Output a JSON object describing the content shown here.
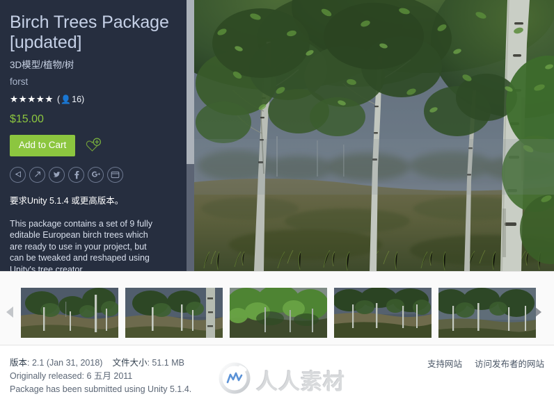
{
  "colors": {
    "panel_bg": "#262e3f",
    "accent_green": "#8cc63f",
    "title_text": "#c5d0e6",
    "page_bg": "#ffffff",
    "carousel_bg": "#fafafa",
    "scrollbar_thumb": "#acb2ba",
    "scrollbar_track": "#5c6474"
  },
  "info_panel": {
    "title": "Birch Trees Package [updated]",
    "breadcrumb": "3D模型/植物/树",
    "publisher": "forst",
    "rating": {
      "stars": "★★★★★",
      "star_count": 5,
      "open_paren": "(",
      "person_icon": "person-icon",
      "reviews": "16",
      "close_paren": ")"
    },
    "price": "$15.00",
    "add_to_cart_label": "Add to Cart",
    "wishlist_icon": "heart-plus-icon",
    "social_icons": [
      {
        "name": "share-icon",
        "glyph": "◁"
      },
      {
        "name": "external-link-icon",
        "glyph": "↗"
      },
      {
        "name": "twitter-icon",
        "glyph": "t"
      },
      {
        "name": "facebook-icon",
        "glyph": "f"
      },
      {
        "name": "google-plus-icon",
        "glyph": "g+"
      },
      {
        "name": "embed-window-icon",
        "glyph": "▤"
      }
    ],
    "unity_requirement": "要求Unity 5.1.4 或更高版本。",
    "description": "This package contains a set of 9 fully editable European birch trees which are ready to use in your project, but can be tweaked and reshaped using Unity's tree creator."
  },
  "hero": {
    "name": "birch-trees-hero-image",
    "alt": "Birch trees forest scene with dark blue sky"
  },
  "carousel": {
    "prev_icon": "chevron-left-icon",
    "next_icon": "chevron-right-icon",
    "thumbnails": [
      {
        "name": "thumbnail-1",
        "alt": "Birch trees on grassy hill"
      },
      {
        "name": "thumbnail-2",
        "alt": "Birch trees with trunk closeup"
      },
      {
        "name": "thumbnail-3",
        "alt": "Bright green birch foliage"
      },
      {
        "name": "thumbnail-4",
        "alt": "Birch trees dark ground"
      },
      {
        "name": "thumbnail-5",
        "alt": "Birch tree near water"
      }
    ]
  },
  "footer": {
    "version_label": "版本",
    "version_value": "2.1 (Jan 31, 2018)",
    "filesize_label": "文件大小",
    "filesize_value": "51.1 MB",
    "originally_released_label": "Originally released",
    "originally_released_value": "6 五月 2011",
    "submitted_note": "Package has been submitted using Unity 5.1.4.",
    "links": [
      {
        "name": "support-website-link",
        "label": "支持网站"
      },
      {
        "name": "publisher-website-link",
        "label": "访问发布者的网站"
      }
    ],
    "watermark_text": "人人素材",
    "watermark_logo": "rrsc-circle-logo"
  }
}
